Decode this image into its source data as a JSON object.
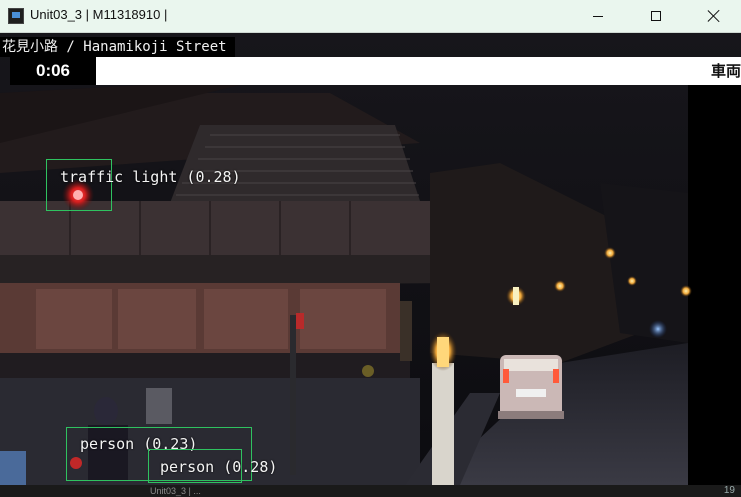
{
  "window": {
    "title": "Unit03_3 | M11318910 |"
  },
  "video": {
    "location": "花見小路 / Hanamikoji Street",
    "timer": "0:06",
    "ticker_text": "車両",
    "detections": [
      {
        "label": "traffic light (0.28)"
      },
      {
        "label": "person (0.23)"
      },
      {
        "label": "person (0.28)"
      }
    ]
  },
  "bottom_strip": {
    "item": "Unit03_3 | ...",
    "number": "19"
  }
}
